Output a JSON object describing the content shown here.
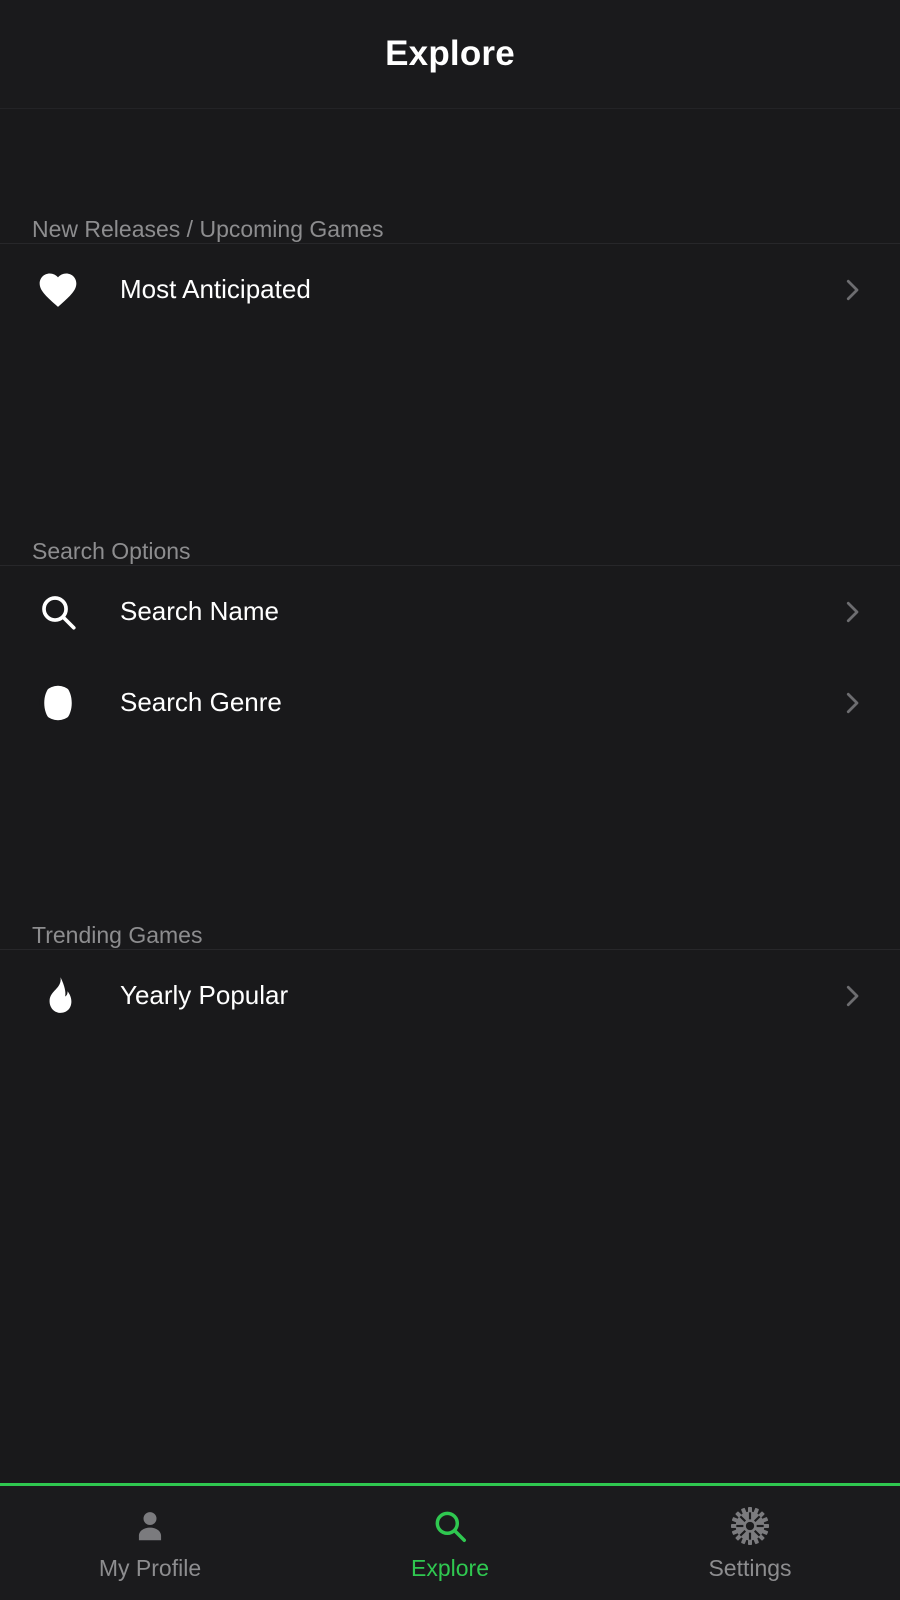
{
  "theme": {
    "background": "#19191b",
    "appbar_background": "#1a1a1c",
    "navbar_background": "#1b1b1d",
    "accent": "#2fc850",
    "divider": "#27272a",
    "text_primary": "#ffffff",
    "text_secondary": "#8d8d8f",
    "chevron": "#6d6d70",
    "icon": "#ffffff"
  },
  "appbar": {
    "title": "Explore"
  },
  "sections": [
    {
      "header": "New Releases / Upcoming Games",
      "items": [
        {
          "label": "Most Anticipated",
          "icon": "heart-icon",
          "chevron": "chevron-right-icon"
        }
      ]
    },
    {
      "header": "Search Options",
      "items": [
        {
          "label": "Search Name",
          "icon": "search-icon",
          "chevron": "chevron-right-icon"
        },
        {
          "label": "Search Genre",
          "icon": "baseball-icon",
          "chevron": "chevron-right-icon"
        }
      ]
    },
    {
      "header": "Trending Games",
      "items": [
        {
          "label": "Yearly Popular",
          "icon": "flame-icon",
          "chevron": "chevron-right-icon"
        }
      ]
    }
  ],
  "bottom_nav": {
    "items": [
      {
        "label": "My Profile",
        "icon": "person-icon",
        "active": false
      },
      {
        "label": "Explore",
        "icon": "search-icon",
        "active": true
      },
      {
        "label": "Settings",
        "icon": "gear-icon",
        "active": false
      }
    ]
  }
}
